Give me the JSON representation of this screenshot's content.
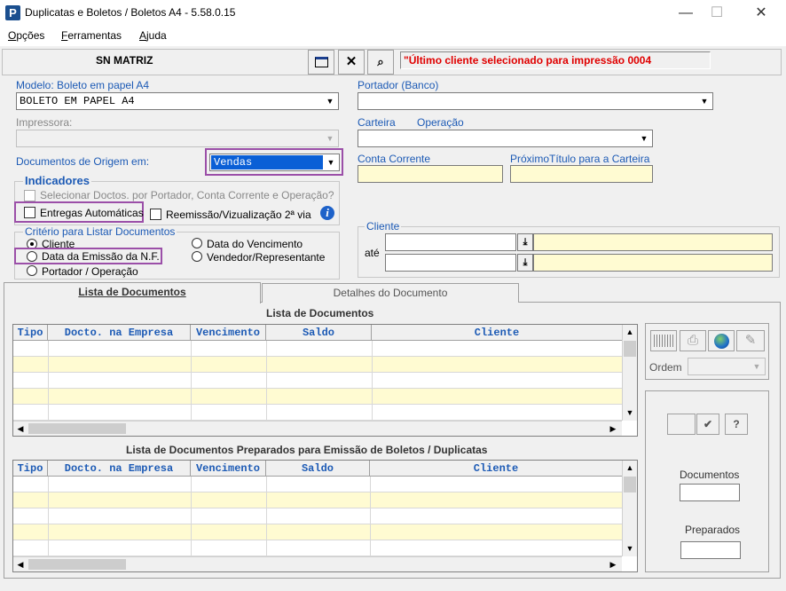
{
  "window": {
    "title": "Duplicatas e Boletos / Boletos A4 - 5.58.0.15",
    "app_icon": "P",
    "minimize": "—",
    "maximize": "☐",
    "close": "✕"
  },
  "menu": {
    "opcoes": {
      "first": "O",
      "rest": "pções"
    },
    "ferramentas": {
      "first": "F",
      "rest": "erramentas"
    },
    "ajuda": {
      "first": "A",
      "rest": "juda"
    }
  },
  "header": {
    "company": "SN MATRIZ",
    "message": "\"Último cliente selecionado para impressão 0004"
  },
  "form": {
    "modelo_label": "Modelo: Boleto em papel A4",
    "modelo_value": "BOLETO EM PAPEL A4",
    "portador_label": "Portador (Banco)",
    "portador_value": "",
    "impressora_label": "Impressora:",
    "impressora_value": "",
    "carteira_label": "Carteira",
    "operacao_label": "Operação",
    "carteira_value": "",
    "documentos_origem_label": "Documentos de Origem em:",
    "documentos_origem_value": "Vendas",
    "conta_corrente_label": "Conta Corrente",
    "conta_corrente_value": "",
    "proximo_titulo_label": "PróximoTítulo para a Carteira",
    "proximo_titulo_value": ""
  },
  "indicadores": {
    "title": "Indicadores",
    "selecionar": "Selecionar Doctos. por Portador, Conta Corrente  e Operação?",
    "entregas": "Entregas Automáticas",
    "reemissao": "Reemissão/Vizualização 2ª via"
  },
  "criterio": {
    "title": "Critério para Listar Documentos",
    "cliente": "Cliente",
    "data_emissao": "Data da Emissão da N.F.",
    "portador_operacao": "Portador / Operação",
    "data_vencimento": "Data do Vencimento",
    "vendedor": "Vendedor/Representante"
  },
  "cliente_group": {
    "title": "Cliente",
    "ate": "até"
  },
  "tabs": {
    "lista": "Lista de Documentos",
    "detalhes": "Detalhes do Documento"
  },
  "lista_documentos": {
    "title": "Lista de Documentos",
    "columns": [
      "Tipo",
      "Docto. na Empresa",
      "Vencimento",
      "Saldo",
      "Cliente"
    ]
  },
  "lista_preparados": {
    "title": "Lista de Documentos Preparados para Emissão de Boletos / Duplicatas",
    "columns": [
      "Tipo",
      "Docto. na Empresa",
      "Vencimento",
      "Saldo",
      "Cliente"
    ]
  },
  "side": {
    "ordem_label": "Ordem",
    "ordem_value": "",
    "documentos_label": "Documentos",
    "preparados_label": "Preparados",
    "check_label": "✔",
    "help_label": "?"
  }
}
